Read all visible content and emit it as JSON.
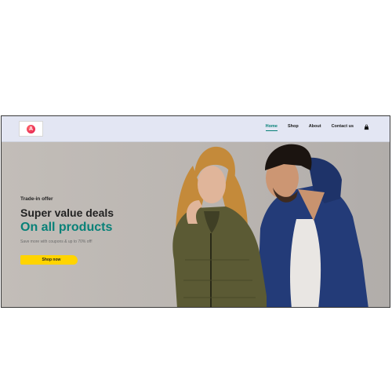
{
  "brand": {
    "logo_icon": "brand-logo-icon",
    "logo_glyph": "A",
    "accent_color": "#e0134d"
  },
  "nav": {
    "items": [
      {
        "label": "Home",
        "active": true
      },
      {
        "label": "Shop",
        "active": false
      },
      {
        "label": "About",
        "active": false
      },
      {
        "label": "Contact us",
        "active": false
      }
    ],
    "cart_icon": "shopping-bag-icon",
    "active_color": "#088178"
  },
  "hero": {
    "eyebrow": "Trade-in offer",
    "headline": "Super value deals",
    "headline_highlight": "On all products",
    "subtext": "Save more with coupons & up to 70% off!",
    "cta_label": "Shop now",
    "cta_color": "#ffd400",
    "image_subject": "fashion-models-photo"
  }
}
